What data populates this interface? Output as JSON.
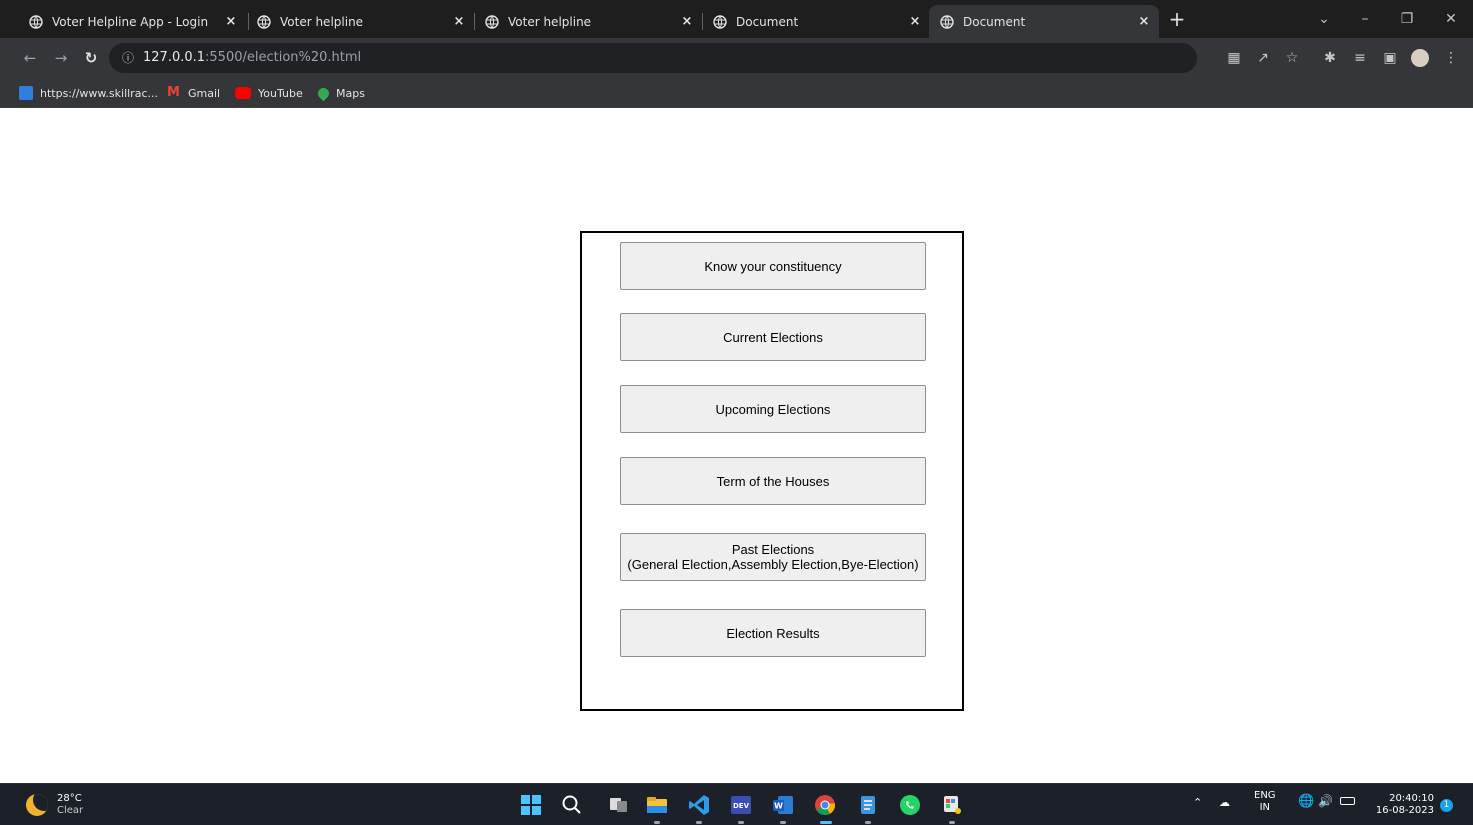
{
  "browser": {
    "tabs": [
      {
        "title": "Voter Helpline App - Login",
        "active": false
      },
      {
        "title": "Voter helpline",
        "active": false
      },
      {
        "title": "Voter helpline",
        "active": false
      },
      {
        "title": "Document",
        "active": false
      },
      {
        "title": "Document",
        "active": true
      }
    ],
    "close_glyph": "×",
    "new_tab_glyph": "+",
    "url_host": "127.0.0.1",
    "url_rest": ":5500/election%20.html",
    "bookmarks": [
      {
        "label": "https://www.skillrac...",
        "icon": "skillrack-icon",
        "color": "#2f7fe0"
      },
      {
        "label": "Gmail",
        "icon": "gmail-icon",
        "color": "#ea4335"
      },
      {
        "label": "YouTube",
        "icon": "youtube-icon",
        "color": "#ff0000"
      },
      {
        "label": "Maps",
        "icon": "maps-icon",
        "color": "#34a853"
      }
    ]
  },
  "main": {
    "buttons": [
      {
        "label": "Know your constituency"
      },
      {
        "label": "Current Elections"
      },
      {
        "label": "Upcoming Elections"
      },
      {
        "label": "Term of the Houses"
      },
      {
        "label": "Past Elections",
        "label2": "(General Election,Assembly Election,Bye-Election)"
      },
      {
        "label": "Election Results"
      }
    ]
  },
  "taskbar": {
    "weather_temp": "28°C",
    "weather_desc": "Clear",
    "language_top": "ENG",
    "language_bottom": "IN",
    "time": "20:40:10",
    "date": "16-08-2023",
    "notification_count": "1",
    "apps": [
      "windows-start-icon",
      "search-icon",
      "task-view-icon",
      "file-explorer-icon",
      "vscode-icon",
      "dev-icon",
      "word-icon",
      "chrome-icon",
      "notepad-icon",
      "whatsapp-icon",
      "paint-icon"
    ]
  }
}
